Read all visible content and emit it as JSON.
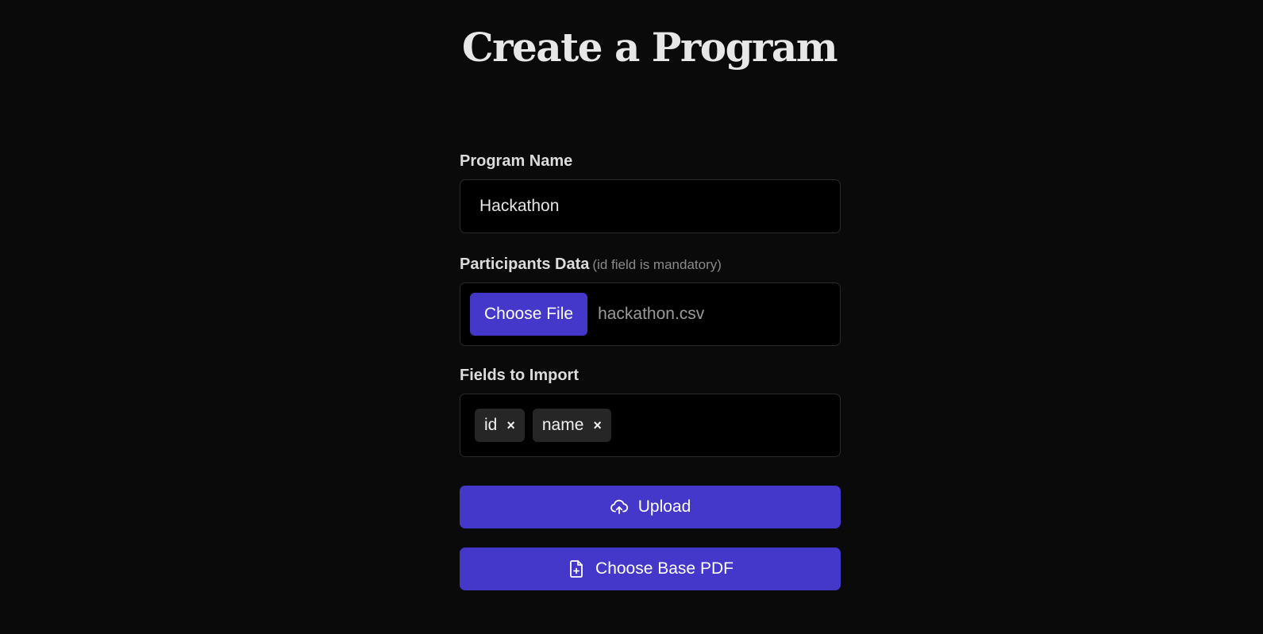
{
  "page": {
    "title": "Create a Program"
  },
  "form": {
    "program_name": {
      "label": "Program Name",
      "value": "Hackathon"
    },
    "participants": {
      "label": "Participants Data",
      "hint": "(id field is mandatory)",
      "choose_label": "Choose File",
      "file_name": "hackathon.csv"
    },
    "fields": {
      "label": "Fields to Import",
      "tags": [
        {
          "label": "id",
          "remove": "×"
        },
        {
          "label": "name",
          "remove": "×"
        }
      ]
    },
    "upload": {
      "label": "Upload",
      "icon": "cloud-upload-icon"
    },
    "base_pdf": {
      "label": "Choose Base PDF",
      "icon": "file-plus-icon"
    }
  },
  "colors": {
    "background": "#0a0a0a",
    "accent": "#4338ca",
    "field_bg": "#000000",
    "tag_bg": "#262626"
  }
}
